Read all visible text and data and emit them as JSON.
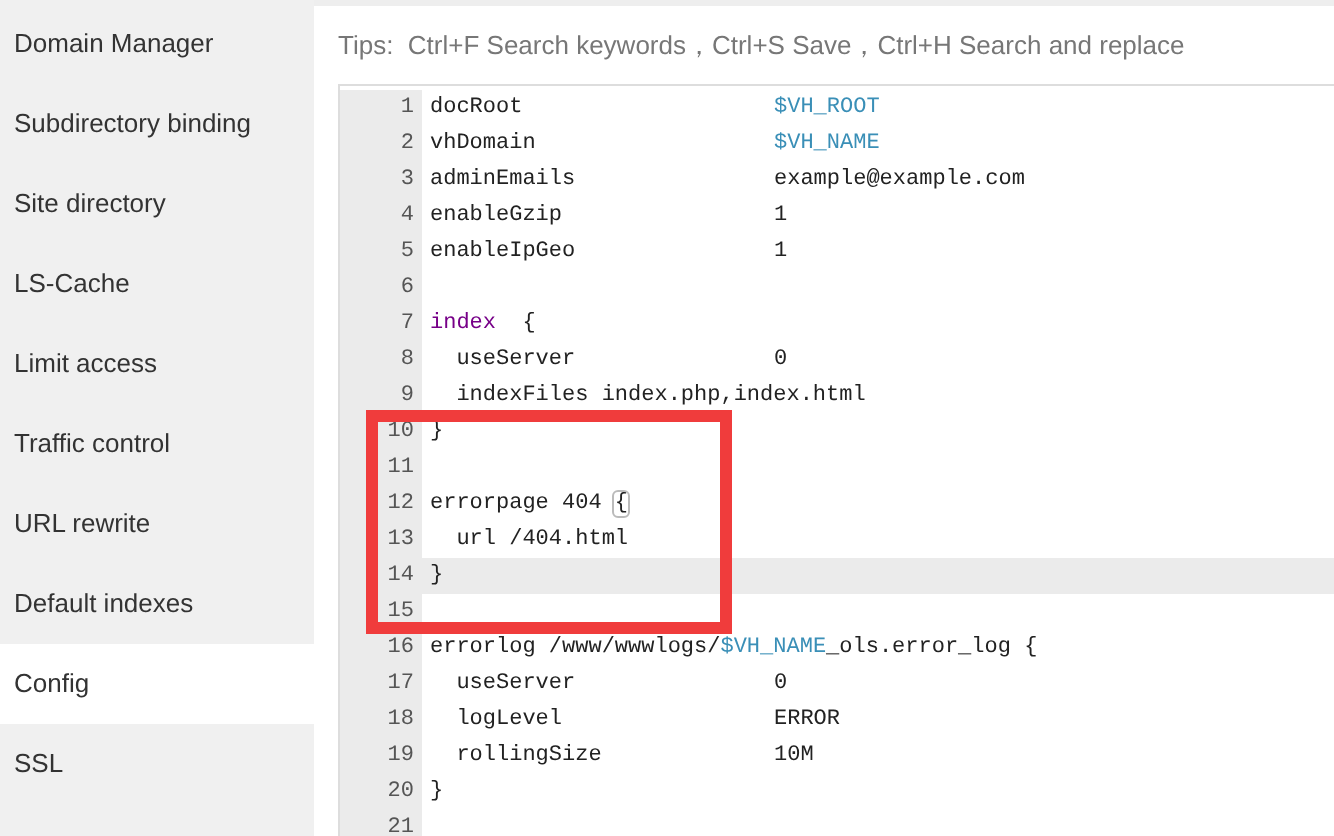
{
  "sidebar": {
    "items": [
      {
        "label": "Domain Manager",
        "selected": false
      },
      {
        "label": "Subdirectory binding",
        "selected": false
      },
      {
        "label": "Site directory",
        "selected": false
      },
      {
        "label": "LS-Cache",
        "selected": false
      },
      {
        "label": "Limit access",
        "selected": false
      },
      {
        "label": "Traffic control",
        "selected": false
      },
      {
        "label": "URL rewrite",
        "selected": false
      },
      {
        "label": "Default indexes",
        "selected": false
      },
      {
        "label": "Config",
        "selected": true
      },
      {
        "label": "SSL",
        "selected": false
      }
    ]
  },
  "tips": "Tips:  Ctrl+F Search keywords，Ctrl+S Save，Ctrl+H Search and replace",
  "editor": {
    "lines": [
      {
        "number": "1",
        "current": false,
        "code": [
          {
            "text": "docRoot",
            "kind": "plain"
          }
        ],
        "value": [
          {
            "text": "$VH_ROOT",
            "kind": "variable"
          }
        ]
      },
      {
        "number": "2",
        "current": false,
        "code": [
          {
            "text": "vhDomain",
            "kind": "plain"
          }
        ],
        "value": [
          {
            "text": "$VH_NAME",
            "kind": "variable"
          }
        ]
      },
      {
        "number": "3",
        "current": false,
        "code": [
          {
            "text": "adminEmails",
            "kind": "plain"
          }
        ],
        "value": [
          {
            "text": "example@example.com",
            "kind": "plain"
          }
        ]
      },
      {
        "number": "4",
        "current": false,
        "code": [
          {
            "text": "enableGzip",
            "kind": "plain"
          }
        ],
        "value": [
          {
            "text": "1",
            "kind": "plain"
          }
        ]
      },
      {
        "number": "5",
        "current": false,
        "code": [
          {
            "text": "enableIpGeo",
            "kind": "plain"
          }
        ],
        "value": [
          {
            "text": "1",
            "kind": "plain"
          }
        ]
      },
      {
        "number": "6",
        "current": false
      },
      {
        "number": "7",
        "current": false,
        "code": [
          {
            "text": "index",
            "kind": "keyword"
          },
          {
            "text": "  {",
            "kind": "plain"
          }
        ]
      },
      {
        "number": "8",
        "current": false,
        "code": [
          {
            "text": "  useServer",
            "kind": "plain"
          }
        ],
        "value": [
          {
            "text": "0",
            "kind": "plain"
          }
        ]
      },
      {
        "number": "9",
        "current": false,
        "code": [
          {
            "text": "  indexFiles index.php,index.html",
            "kind": "plain"
          }
        ]
      },
      {
        "number": "10",
        "current": false,
        "code": [
          {
            "text": "}",
            "kind": "plain"
          }
        ]
      },
      {
        "number": "11",
        "current": false
      },
      {
        "number": "12",
        "current": false,
        "code": [
          {
            "text": "errorpage 404 ",
            "kind": "plain"
          },
          {
            "text": "{",
            "kind": "matched-bracket"
          }
        ]
      },
      {
        "number": "13",
        "current": false,
        "code": [
          {
            "text": "  url /404.html",
            "kind": "plain"
          }
        ]
      },
      {
        "number": "14",
        "current": true,
        "code": [
          {
            "text": "}",
            "kind": "plain"
          }
        ]
      },
      {
        "number": "15",
        "current": false
      },
      {
        "number": "16",
        "current": false,
        "code": [
          {
            "text": "errorlog /www/wwwlogs/",
            "kind": "plain"
          },
          {
            "text": "$VH_NAME",
            "kind": "variable"
          },
          {
            "text": "_ols.error_log {",
            "kind": "plain"
          }
        ]
      },
      {
        "number": "17",
        "current": false,
        "code": [
          {
            "text": "  useServer",
            "kind": "plain"
          }
        ],
        "value": [
          {
            "text": "0",
            "kind": "plain"
          }
        ]
      },
      {
        "number": "18",
        "current": false,
        "code": [
          {
            "text": "  logLevel",
            "kind": "plain"
          }
        ],
        "value": [
          {
            "text": "ERROR",
            "kind": "plain"
          }
        ]
      },
      {
        "number": "19",
        "current": false,
        "code": [
          {
            "text": "  rollingSize",
            "kind": "plain"
          }
        ],
        "value": [
          {
            "text": "10M",
            "kind": "plain"
          }
        ]
      },
      {
        "number": "20",
        "current": false,
        "code": [
          {
            "text": "}",
            "kind": "plain"
          }
        ]
      },
      {
        "number": "21",
        "current": false
      }
    ]
  }
}
